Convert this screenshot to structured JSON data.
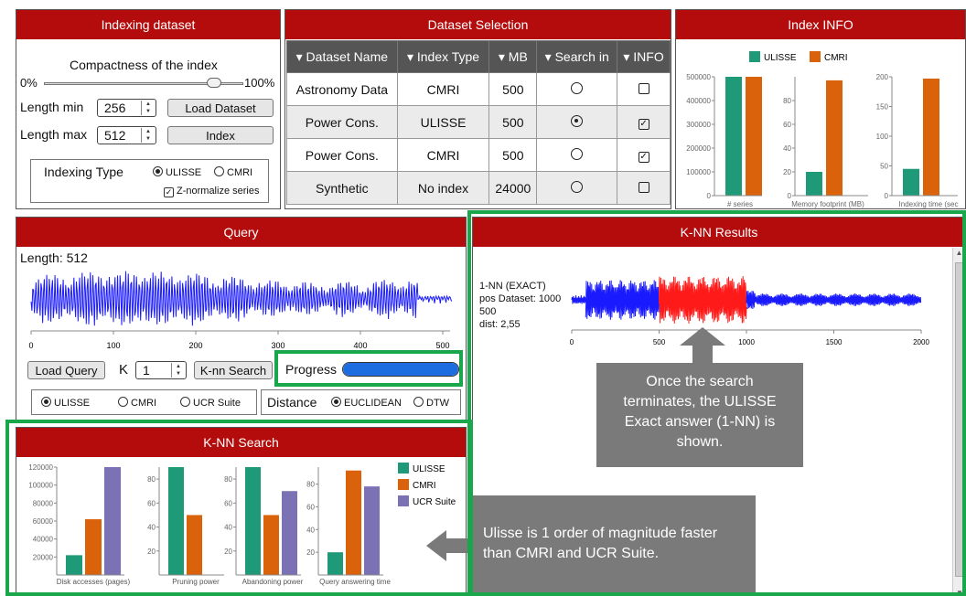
{
  "indexing": {
    "title": "Indexing dataset",
    "compactness_label": "Compactness of the index",
    "slider_min": "0%",
    "slider_max": "100%",
    "compactness_value": 0.85,
    "length_min_label": "Length min",
    "length_min_value": "256",
    "length_max_label": "Length max",
    "length_max_value": "512",
    "load_dataset_label": "Load Dataset",
    "index_label": "Index",
    "indexing_type_label": "Indexing Type",
    "type_ulisse": "ULISSE",
    "type_cmri": "CMRI",
    "znorm_label": "Z-normalize series"
  },
  "dataset": {
    "title": "Dataset Selection",
    "headers": [
      "▾ Dataset Name",
      "▾ Index Type",
      "▾ MB",
      "▾ Search in",
      "▾ INFO"
    ],
    "rows": [
      {
        "name": "Astronomy Data",
        "index": "CMRI",
        "mb": "500",
        "search": false,
        "info": false
      },
      {
        "name": "Power Cons.",
        "index": "ULISSE",
        "mb": "500",
        "search": true,
        "info": true
      },
      {
        "name": "Power Cons.",
        "index": "CMRI",
        "mb": "500",
        "search": false,
        "info": true
      },
      {
        "name": "Synthetic",
        "index": "No index",
        "mb": "24000",
        "search": false,
        "info": false
      }
    ]
  },
  "index_info": {
    "title": "Index INFO",
    "legend_ulisse": "ULISSE",
    "legend_cmri": "CMRI",
    "colors": {
      "ulisse": "#1e9a78",
      "cmri": "#d9620b",
      "ucr": "#7b71b5"
    },
    "chart_data": [
      {
        "type": "bar",
        "xlabel": "# series",
        "series": [
          {
            "name": "ULISSE",
            "values": [
              500000
            ]
          },
          {
            "name": "CMRI",
            "values": [
              500000
            ]
          }
        ],
        "ylim": [
          0,
          500000
        ],
        "ticks": [
          "0",
          "100000",
          "200000",
          "300000",
          "400000",
          "500000"
        ]
      },
      {
        "type": "bar",
        "xlabel": "Memory footprint (MB)",
        "series": [
          {
            "name": "ULISSE",
            "values": [
              20
            ]
          },
          {
            "name": "CMRI",
            "values": [
              97
            ]
          }
        ],
        "ylim": [
          0,
          100
        ],
        "ticks": [
          "0",
          "20",
          "40",
          "60",
          "80"
        ]
      },
      {
        "type": "bar",
        "xlabel": "Indexing time (sec",
        "series": [
          {
            "name": "ULISSE",
            "values": [
              45
            ]
          },
          {
            "name": "CMRI",
            "values": [
              197
            ]
          }
        ],
        "ylim": [
          0,
          200
        ],
        "ticks": [
          "0",
          "50",
          "100",
          "150",
          "200"
        ]
      }
    ]
  },
  "query": {
    "title": "Query",
    "length_label": "Length: 512",
    "x_ticks": [
      "0",
      "100",
      "200",
      "300",
      "400",
      "500"
    ],
    "load_query_label": "Load Query",
    "k_label": "K",
    "k_value": "1",
    "knn_search_label": "K-nn Search",
    "progress_label": "Progress",
    "progress_value": 1.0,
    "algo_ulisse": "ULISSE",
    "algo_cmri": "CMRI",
    "algo_ucr": "UCR Suite",
    "distance_label": "Distance",
    "dist_euclidean": "EUCLIDEAN",
    "dist_dtw": "DTW"
  },
  "results": {
    "title": "K-NN Results",
    "lines": [
      "1-NN (EXACT)",
      "pos Dataset: 1000",
      "500",
      "dist: 2,55"
    ],
    "x_ticks": [
      "0",
      "500",
      "1000",
      "1500",
      "2000"
    ],
    "callout": "Once the search terminates, the ULISSE Exact answer (1-NN) is shown."
  },
  "knn_search": {
    "title": "K-NN Search",
    "legend": [
      "ULISSE",
      "CMRI",
      "UCR Suite"
    ],
    "callout": "Ulisse is 1 order of magnitude faster than CMRI and UCR Suite.",
    "chart_data": [
      {
        "type": "bar",
        "xlabel": "Disk accesses (pages)",
        "values": [
          22000,
          62000,
          120000
        ],
        "ylim": [
          0,
          120000
        ],
        "ticks": [
          "20000",
          "40000",
          "60000",
          "80000",
          "100000",
          "120000"
        ]
      },
      {
        "type": "bar",
        "xlabel": "Pruning power",
        "values": [
          92,
          50
        ],
        "ylim": [
          0,
          90
        ],
        "ticks": [
          "20",
          "40",
          "60",
          "80"
        ]
      },
      {
        "type": "bar",
        "xlabel": "Abandoning power",
        "values": [
          92,
          50,
          70
        ],
        "ylim": [
          0,
          90
        ],
        "ticks": [
          "20",
          "40",
          "60",
          "80"
        ]
      },
      {
        "type": "bar",
        "xlabel": "Query answering time",
        "values": [
          20,
          92,
          78
        ],
        "ylim": [
          0,
          95
        ],
        "ticks": [
          "20",
          "40",
          "60",
          "80"
        ]
      }
    ]
  }
}
